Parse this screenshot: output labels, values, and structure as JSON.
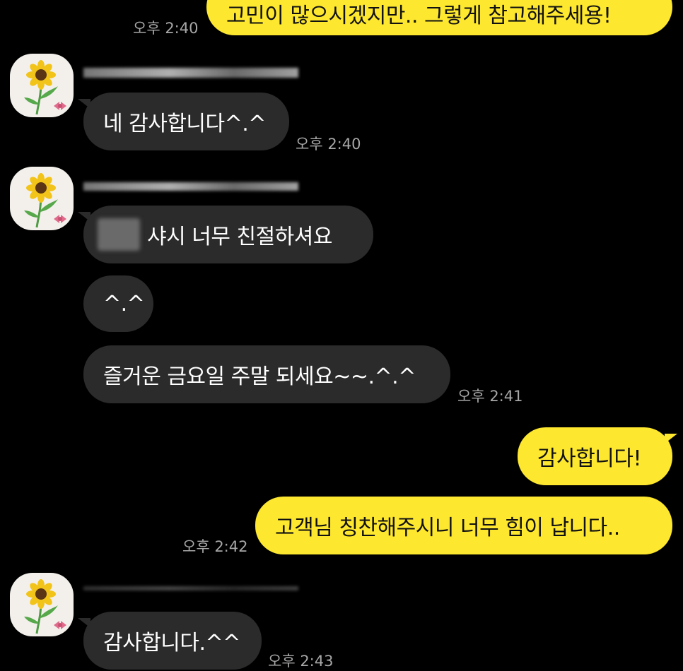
{
  "colors": {
    "background": "#000000",
    "incoming_bubble": "#2b2b2b",
    "outgoing_bubble": "#fde72f",
    "timestamp": "#a7a7a7"
  },
  "messages": {
    "m0": {
      "text": "고민이 많으시겠지만.. 그렇게 참고해주세용!",
      "time": "오후 2:40"
    },
    "m1": {
      "text": "네 감사합니다^.^",
      "time": "오후 2:40"
    },
    "m2": {
      "text": "샤시 너무 친절하셔요"
    },
    "m3": {
      "text": "^.^"
    },
    "m4": {
      "text": "즐거운 금요일  주말 되세요~~.^.^",
      "time": "오후 2:41"
    },
    "m5": {
      "text": "감사합니다!"
    },
    "m6": {
      "text": "고객님 칭찬해주시니 너무 힘이 납니다..",
      "time": "오후 2:42"
    },
    "m7": {
      "text": "감사합니다.^^",
      "time": "오후 2:43"
    }
  },
  "avatar_icon": "sunflower-icon"
}
